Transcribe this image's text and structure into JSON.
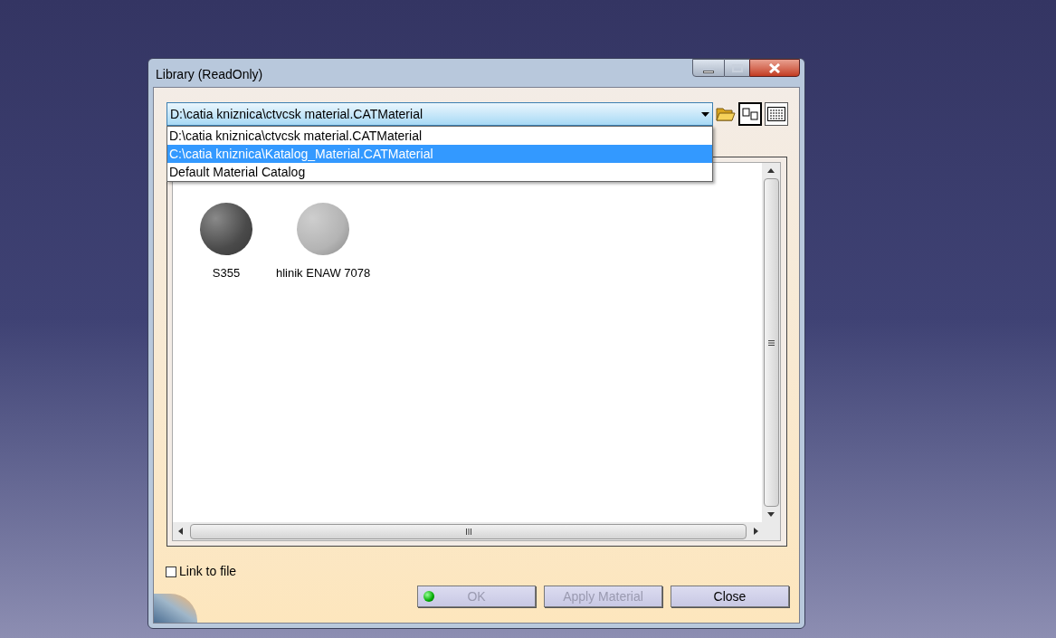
{
  "window": {
    "title": "Library (ReadOnly)"
  },
  "library_combo": {
    "value": "D:\\catia kniznica\\ctvcsk material.CATMaterial",
    "expanded": true
  },
  "library_options": [
    {
      "label": "D:\\catia kniznica\\ctvcsk material.CATMaterial",
      "selected": false
    },
    {
      "label": "C:\\catia kniznica\\Katalog_Material.CATMaterial",
      "selected": true
    },
    {
      "label": "Default Material Catalog",
      "selected": false
    }
  ],
  "materials": [
    {
      "name": "S355",
      "color": "#4a4a4a"
    },
    {
      "name": "hlinik ENAW 7078",
      "color": "#b4b4b4"
    }
  ],
  "link_to_file": {
    "label": "Link to file",
    "checked": false
  },
  "buttons": [
    {
      "label": "OK",
      "disabled": true,
      "kind": "ok"
    },
    {
      "label": "Apply Material",
      "disabled": true,
      "kind": "plain"
    },
    {
      "label": "Close",
      "disabled": false,
      "kind": "plain"
    }
  ]
}
